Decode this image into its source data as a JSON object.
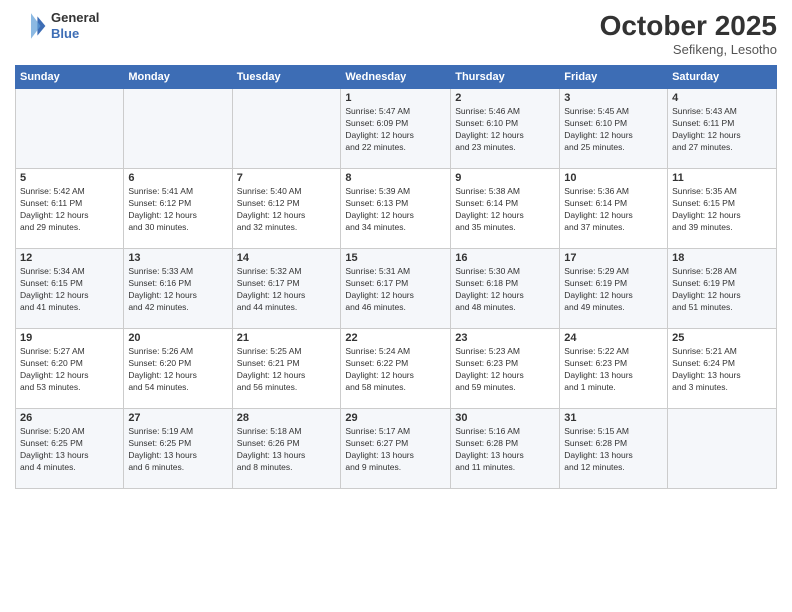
{
  "header": {
    "logo_line1": "General",
    "logo_line2": "Blue",
    "month": "October 2025",
    "location": "Sefikeng, Lesotho"
  },
  "weekdays": [
    "Sunday",
    "Monday",
    "Tuesday",
    "Wednesday",
    "Thursday",
    "Friday",
    "Saturday"
  ],
  "weeks": [
    [
      {
        "day": "",
        "info": ""
      },
      {
        "day": "",
        "info": ""
      },
      {
        "day": "",
        "info": ""
      },
      {
        "day": "1",
        "info": "Sunrise: 5:47 AM\nSunset: 6:09 PM\nDaylight: 12 hours\nand 22 minutes."
      },
      {
        "day": "2",
        "info": "Sunrise: 5:46 AM\nSunset: 6:10 PM\nDaylight: 12 hours\nand 23 minutes."
      },
      {
        "day": "3",
        "info": "Sunrise: 5:45 AM\nSunset: 6:10 PM\nDaylight: 12 hours\nand 25 minutes."
      },
      {
        "day": "4",
        "info": "Sunrise: 5:43 AM\nSunset: 6:11 PM\nDaylight: 12 hours\nand 27 minutes."
      }
    ],
    [
      {
        "day": "5",
        "info": "Sunrise: 5:42 AM\nSunset: 6:11 PM\nDaylight: 12 hours\nand 29 minutes."
      },
      {
        "day": "6",
        "info": "Sunrise: 5:41 AM\nSunset: 6:12 PM\nDaylight: 12 hours\nand 30 minutes."
      },
      {
        "day": "7",
        "info": "Sunrise: 5:40 AM\nSunset: 6:12 PM\nDaylight: 12 hours\nand 32 minutes."
      },
      {
        "day": "8",
        "info": "Sunrise: 5:39 AM\nSunset: 6:13 PM\nDaylight: 12 hours\nand 34 minutes."
      },
      {
        "day": "9",
        "info": "Sunrise: 5:38 AM\nSunset: 6:14 PM\nDaylight: 12 hours\nand 35 minutes."
      },
      {
        "day": "10",
        "info": "Sunrise: 5:36 AM\nSunset: 6:14 PM\nDaylight: 12 hours\nand 37 minutes."
      },
      {
        "day": "11",
        "info": "Sunrise: 5:35 AM\nSunset: 6:15 PM\nDaylight: 12 hours\nand 39 minutes."
      }
    ],
    [
      {
        "day": "12",
        "info": "Sunrise: 5:34 AM\nSunset: 6:15 PM\nDaylight: 12 hours\nand 41 minutes."
      },
      {
        "day": "13",
        "info": "Sunrise: 5:33 AM\nSunset: 6:16 PM\nDaylight: 12 hours\nand 42 minutes."
      },
      {
        "day": "14",
        "info": "Sunrise: 5:32 AM\nSunset: 6:17 PM\nDaylight: 12 hours\nand 44 minutes."
      },
      {
        "day": "15",
        "info": "Sunrise: 5:31 AM\nSunset: 6:17 PM\nDaylight: 12 hours\nand 46 minutes."
      },
      {
        "day": "16",
        "info": "Sunrise: 5:30 AM\nSunset: 6:18 PM\nDaylight: 12 hours\nand 48 minutes."
      },
      {
        "day": "17",
        "info": "Sunrise: 5:29 AM\nSunset: 6:19 PM\nDaylight: 12 hours\nand 49 minutes."
      },
      {
        "day": "18",
        "info": "Sunrise: 5:28 AM\nSunset: 6:19 PM\nDaylight: 12 hours\nand 51 minutes."
      }
    ],
    [
      {
        "day": "19",
        "info": "Sunrise: 5:27 AM\nSunset: 6:20 PM\nDaylight: 12 hours\nand 53 minutes."
      },
      {
        "day": "20",
        "info": "Sunrise: 5:26 AM\nSunset: 6:20 PM\nDaylight: 12 hours\nand 54 minutes."
      },
      {
        "day": "21",
        "info": "Sunrise: 5:25 AM\nSunset: 6:21 PM\nDaylight: 12 hours\nand 56 minutes."
      },
      {
        "day": "22",
        "info": "Sunrise: 5:24 AM\nSunset: 6:22 PM\nDaylight: 12 hours\nand 58 minutes."
      },
      {
        "day": "23",
        "info": "Sunrise: 5:23 AM\nSunset: 6:23 PM\nDaylight: 12 hours\nand 59 minutes."
      },
      {
        "day": "24",
        "info": "Sunrise: 5:22 AM\nSunset: 6:23 PM\nDaylight: 13 hours\nand 1 minute."
      },
      {
        "day": "25",
        "info": "Sunrise: 5:21 AM\nSunset: 6:24 PM\nDaylight: 13 hours\nand 3 minutes."
      }
    ],
    [
      {
        "day": "26",
        "info": "Sunrise: 5:20 AM\nSunset: 6:25 PM\nDaylight: 13 hours\nand 4 minutes."
      },
      {
        "day": "27",
        "info": "Sunrise: 5:19 AM\nSunset: 6:25 PM\nDaylight: 13 hours\nand 6 minutes."
      },
      {
        "day": "28",
        "info": "Sunrise: 5:18 AM\nSunset: 6:26 PM\nDaylight: 13 hours\nand 8 minutes."
      },
      {
        "day": "29",
        "info": "Sunrise: 5:17 AM\nSunset: 6:27 PM\nDaylight: 13 hours\nand 9 minutes."
      },
      {
        "day": "30",
        "info": "Sunrise: 5:16 AM\nSunset: 6:28 PM\nDaylight: 13 hours\nand 11 minutes."
      },
      {
        "day": "31",
        "info": "Sunrise: 5:15 AM\nSunset: 6:28 PM\nDaylight: 13 hours\nand 12 minutes."
      },
      {
        "day": "",
        "info": ""
      }
    ]
  ]
}
